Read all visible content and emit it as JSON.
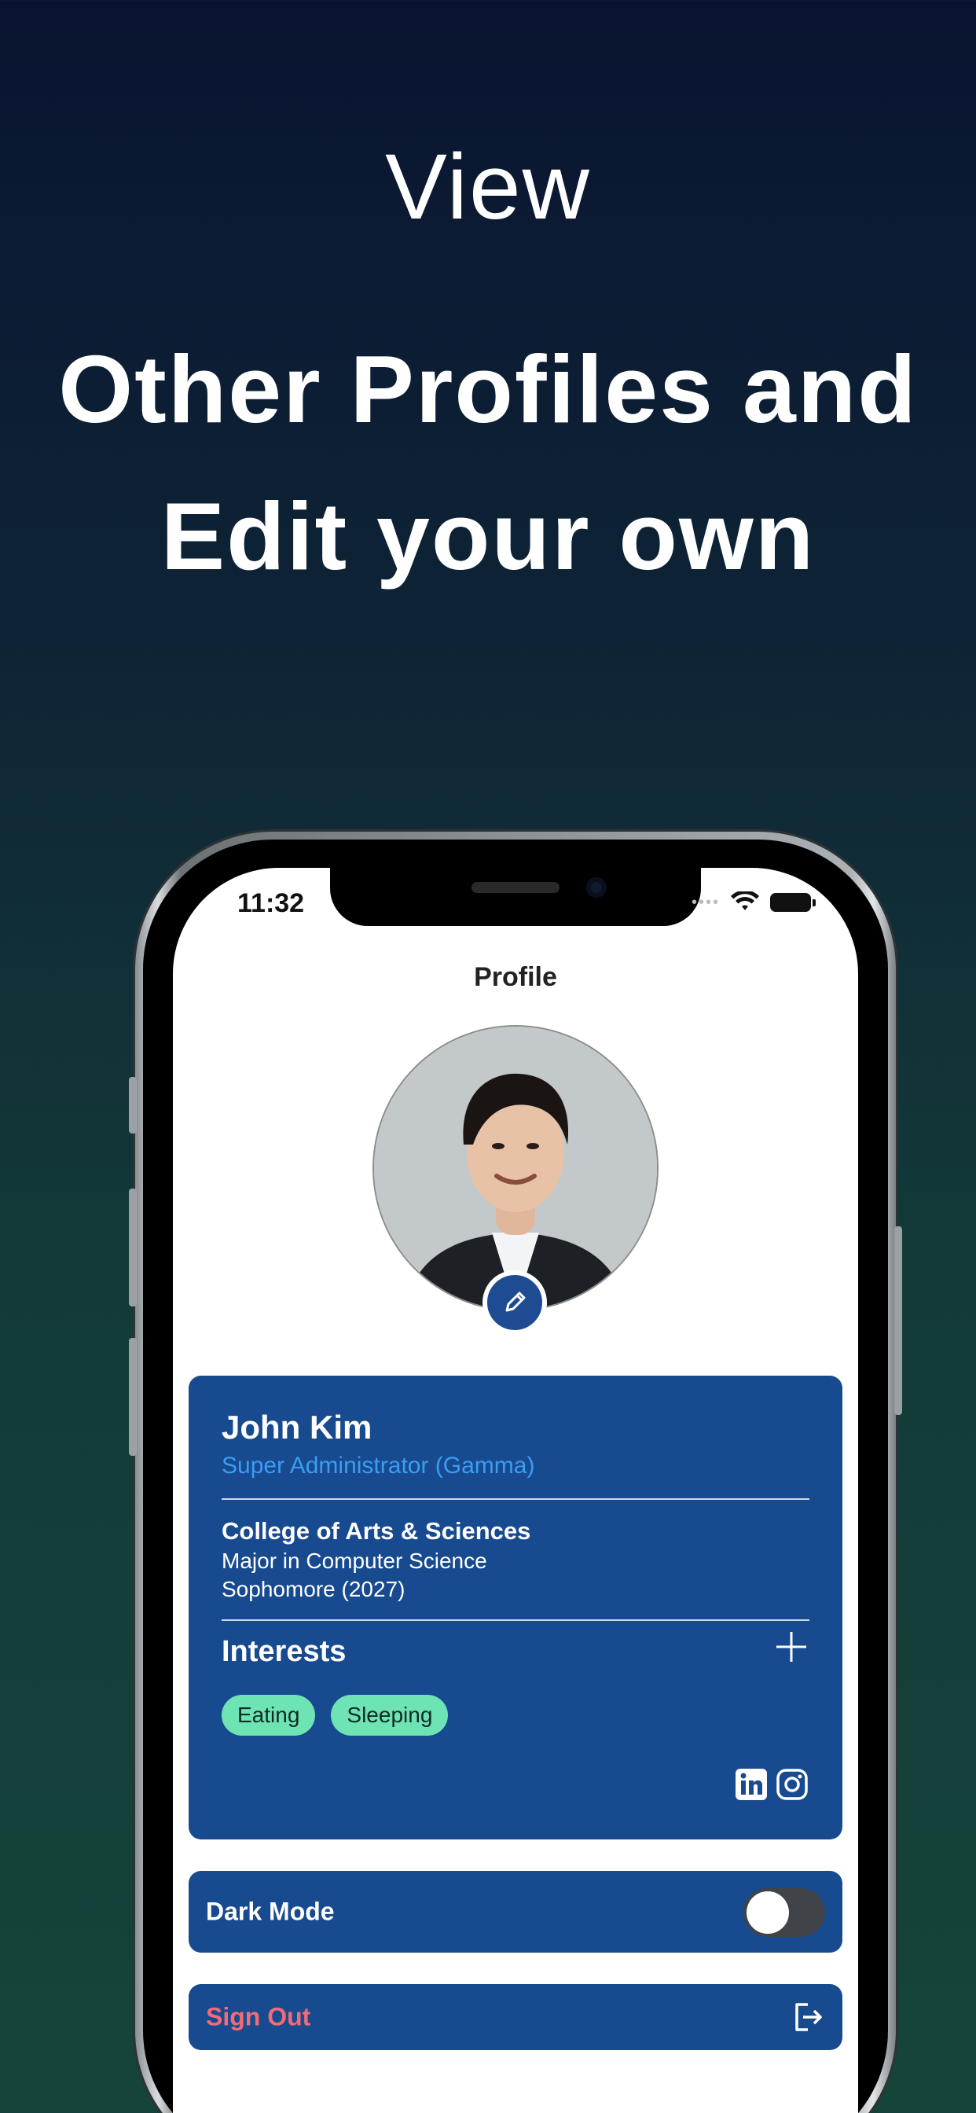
{
  "headline": {
    "line1": "View",
    "line2": "Other Profiles and",
    "line3": "Edit your own"
  },
  "status_bar": {
    "time": "11:32"
  },
  "nav": {
    "title": "Profile"
  },
  "profile": {
    "name": "John Kim",
    "role": "Super Administrator (Gamma)",
    "college": "College of Arts & Sciences",
    "major": "Major in Computer Science",
    "year": "Sophomore (2027)"
  },
  "interests": {
    "title": "Interests",
    "items": [
      "Eating",
      "Sleeping"
    ]
  },
  "settings": {
    "dark_mode_label": "Dark Mode",
    "dark_mode_on": false,
    "sign_out_label": "Sign Out"
  },
  "colors": {
    "card": "#174a8f",
    "role_text": "#3b9df2",
    "chip": "#6ee3b3",
    "sign_out_text": "#f36b74"
  },
  "icons": [
    "pencil-icon",
    "plus-icon",
    "linkedin-icon",
    "instagram-icon",
    "sign-out-icon",
    "wifi-icon",
    "battery-icon"
  ]
}
